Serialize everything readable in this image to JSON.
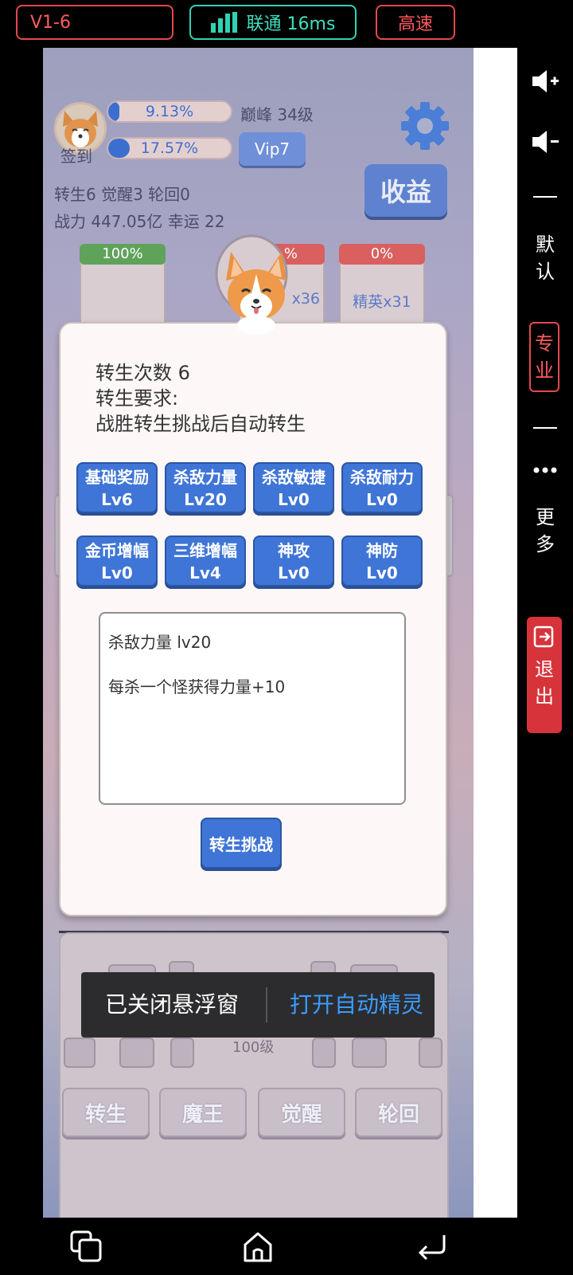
{
  "top_bar": {
    "version": "V1-6",
    "network": "联通 16ms",
    "speed": "高速"
  },
  "side_panel": {
    "volume_up": "volume-up-icon",
    "volume_down": "volume-down-icon",
    "default": [
      "默",
      "认"
    ],
    "pro": [
      "专",
      "业"
    ],
    "more": [
      "更",
      "多"
    ],
    "exit": [
      "退",
      "出"
    ]
  },
  "player": {
    "checkin_label": "签到",
    "bar1_text": "9.13%",
    "bar1_progress": 0.0913,
    "bar2_text": "17.57%",
    "bar2_progress": 0.1757,
    "peak": "巅峰 34级",
    "vip": "Vip7",
    "income": "收益",
    "rebirth_line": "转生6 觉醒3 轮回0",
    "power_line": "战力 447.05亿  幸运 22"
  },
  "cards": [
    {
      "header": "100%",
      "header_color": "#5fa35a",
      "body": ""
    },
    {
      "header": "%",
      "header_color": "#d9605e",
      "body": "x36"
    },
    {
      "header": "0%",
      "header_color": "#d9605e",
      "body": "精英x31"
    }
  ],
  "modal": {
    "rebirth_count": "转生次数 6",
    "requirement_label": "转生要求:",
    "requirement_text": "战胜转生挑战后自动转生",
    "skills": [
      {
        "name": "基础奖励",
        "level": "Lv6"
      },
      {
        "name": "杀敌力量",
        "level": "Lv20"
      },
      {
        "name": "杀敌敏捷",
        "level": "Lv0"
      },
      {
        "name": "杀敌耐力",
        "level": "Lv0"
      },
      {
        "name": "金币增幅",
        "level": "Lv0"
      },
      {
        "name": "三维增幅",
        "level": "Lv4"
      },
      {
        "name": "神攻",
        "level": "Lv0"
      },
      {
        "name": "神防",
        "level": "Lv0"
      }
    ],
    "desc_title": "杀敌力量 lv20",
    "desc_body": "每杀一个怪获得力量+10",
    "challenge_button": "转生挑战"
  },
  "bottom": {
    "level_text": "100级",
    "buttons": [
      "转生",
      "魔王",
      "觉醒",
      "轮回"
    ]
  },
  "toast": {
    "left": "已关闭悬浮窗",
    "right": "打开自动精灵"
  }
}
